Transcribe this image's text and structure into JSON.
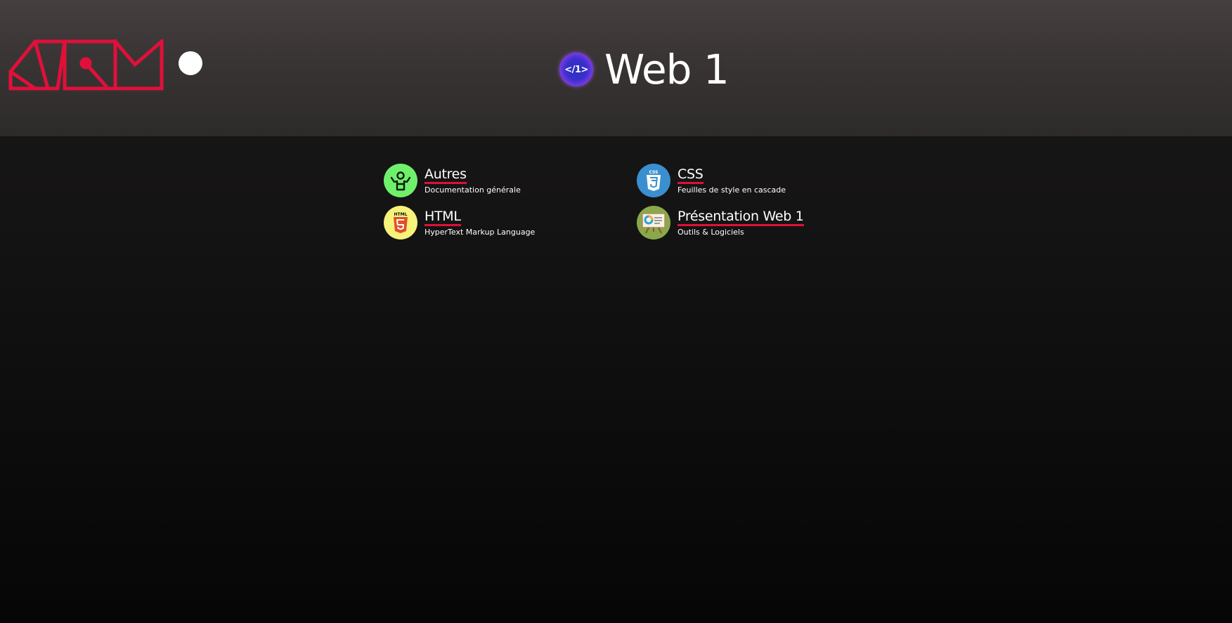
{
  "header": {
    "title": "Web 1",
    "badge_text": "</1>",
    "logo_name": "site-logo",
    "logo_color": "#e0103a"
  },
  "nav": {
    "items": [
      {
        "label": "Autres",
        "description": "Documentation générale",
        "icon": "person-shrug-icon",
        "icon_bg": "#6ff06a"
      },
      {
        "label": "CSS",
        "description": "Feuilles de style en cascade",
        "icon": "css3-icon",
        "icon_bg": "#3a8fce",
        "icon_text": "CSS"
      },
      {
        "label": "HTML",
        "description": "HyperText Markup Language",
        "icon": "html5-icon",
        "icon_bg": "#f7f27a",
        "icon_text": "HTML"
      },
      {
        "label": "Présentation Web 1",
        "description": "Outils & Logiciels",
        "icon": "presentation-board-icon",
        "icon_bg": "#8aa84a"
      }
    ]
  },
  "colors": {
    "accent": "#e0103a",
    "header_bg": "#3a3535",
    "body_bg": "#121111"
  }
}
